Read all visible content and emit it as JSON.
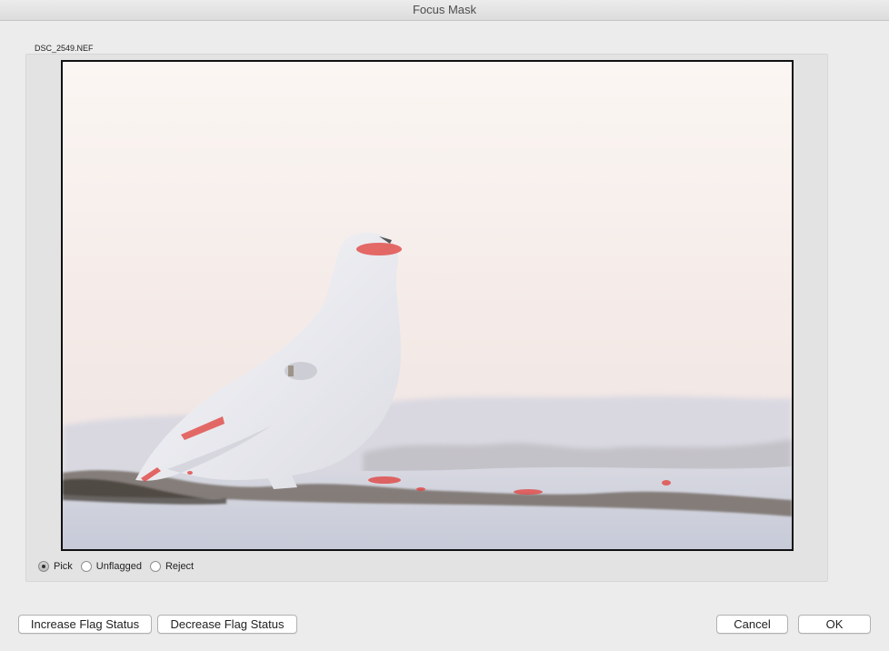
{
  "window": {
    "title": "Focus Mask"
  },
  "image": {
    "filename": "DSC_2549.NEF"
  },
  "flag_options": [
    {
      "label": "Pick",
      "selected": true
    },
    {
      "label": "Unflagged",
      "selected": false
    },
    {
      "label": "Reject",
      "selected": false
    }
  ],
  "buttons": {
    "increase_flag": "Increase Flag Status",
    "decrease_flag": "Decrease Flag Status",
    "cancel": "Cancel",
    "ok": "OK"
  },
  "colors": {
    "focus_highlight": "#e0423f",
    "window_bg": "#ececec"
  }
}
